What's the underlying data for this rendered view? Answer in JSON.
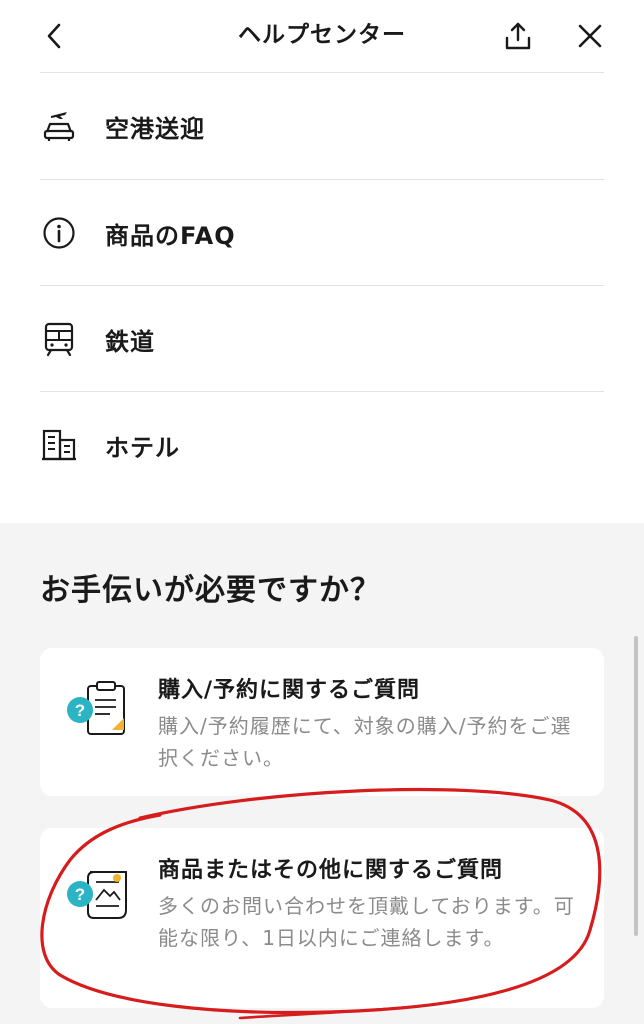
{
  "header": {
    "title": "ヘルプセンター",
    "back_icon": "chevron-left-icon",
    "share_icon": "share-icon",
    "close_icon": "close-icon"
  },
  "menu": {
    "items": [
      {
        "label": "空港送迎",
        "icon": "airport-transfer-icon"
      },
      {
        "label": "商品のFAQ",
        "icon": "info-icon"
      },
      {
        "label": "鉄道",
        "icon": "train-icon"
      },
      {
        "label": "ホテル",
        "icon": "hotel-icon"
      }
    ]
  },
  "help": {
    "title": "お手伝いが必要ですか？",
    "cards": [
      {
        "title": "購入/予約に関するご質問",
        "description": "購入/予約履歴にて、対象の購入/予約をご選択ください。",
        "icon": "booking-question-icon"
      },
      {
        "title": "商品またはその他に関するご質問",
        "description": "多くのお問い合わせを頂戴しております。可能な限り、1日以内にご連絡します。",
        "icon": "product-question-icon"
      }
    ]
  },
  "colors": {
    "text": "#1a1a1a",
    "muted": "#8b8b8b",
    "section_bg": "#f4f4f4",
    "accent_teal": "#2bb5c4",
    "accent_yellow": "#f2b12e",
    "annotation_red": "#d61c1c"
  }
}
